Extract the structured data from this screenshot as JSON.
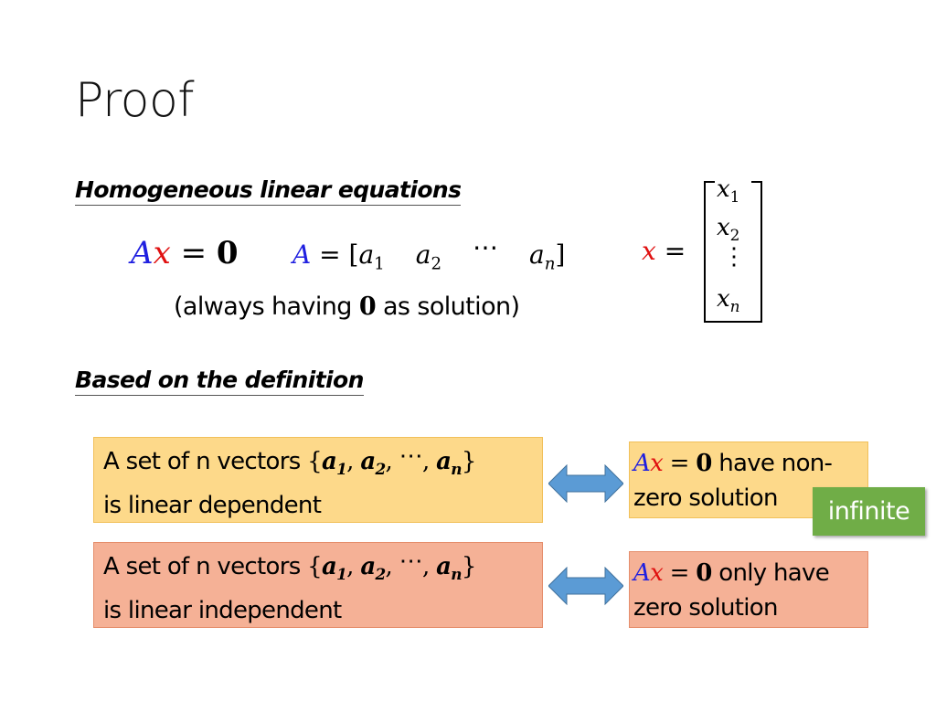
{
  "slide": {
    "title": "Proof",
    "section1": {
      "heading": "Homogeneous linear equations",
      "equation": {
        "lhs_A": "A",
        "lhs_x": "x",
        "equals": "=",
        "rhs": "0"
      },
      "matrix_A": {
        "label": "A",
        "equals": "=",
        "open": "[",
        "close": "]",
        "cols": [
          "a",
          "a",
          "⋯",
          "a"
        ],
        "subs": [
          "1",
          "2",
          "",
          "n"
        ]
      },
      "note": {
        "prefix": "(always having ",
        "zero": "0",
        "suffix": " as solution)"
      },
      "vector_x": {
        "label": "x",
        "equals": "=",
        "rows": [
          "x",
          "x",
          "⋮",
          "x"
        ],
        "subs": [
          "1",
          "2",
          "",
          "n"
        ]
      }
    },
    "section2": {
      "heading": "Based on the definition",
      "rows": [
        {
          "left_prefix": "A set of n vectors ",
          "set": {
            "open": "{",
            "a": "a",
            "s1": "1",
            "s2": "2",
            "dots": "⋯",
            "sn": "n",
            "close": "}",
            "comma": ", "
          },
          "left_line2": "is linear dependent",
          "right_A": "A",
          "right_x": "x",
          "right_eq": " = ",
          "right_zero": "0",
          "right_rest": " have non-",
          "right_line2": "zero solution",
          "color": "#fdd98a"
        },
        {
          "left_prefix": "A set of n vectors ",
          "set": {
            "open": "{",
            "a": "a",
            "s1": "1",
            "s2": "2",
            "dots": "⋯",
            "sn": "n",
            "close": "}",
            "comma": ", "
          },
          "left_line2": "is linear independent",
          "right_A": "A",
          "right_x": "x",
          "right_eq": " = ",
          "right_zero": "0",
          "right_rest": " only have",
          "right_line2": "zero solution",
          "color": "#f5b196"
        }
      ],
      "badge": {
        "label": "infinite",
        "color": "#70ad47"
      },
      "arrow_color": "#5b9bd5"
    }
  }
}
